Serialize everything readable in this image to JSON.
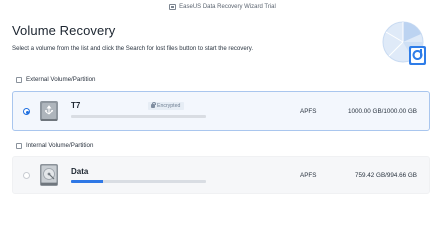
{
  "window": {
    "title": "EaseUS Data Recovery Wizard  Trial"
  },
  "page": {
    "title": "Volume Recovery",
    "subtitle": "Select a volume from the list and click the Search for lost files button to start the recovery."
  },
  "sections": [
    {
      "label": "External Volume/Partition",
      "volumes": [
        {
          "name": "T7",
          "badge": "Encrypted",
          "filesystem": "APFS",
          "capacity": "1000.00 GB/1000.00 GB",
          "used_fraction": 0.0,
          "selected": true,
          "icon": "usb-drive-icon"
        }
      ]
    },
    {
      "label": "Internal Volume/Partition",
      "volumes": [
        {
          "name": "Data",
          "filesystem": "APFS",
          "capacity": "759.42 GB/994.66 GB",
          "used_fraction": 0.24,
          "selected": false,
          "icon": "hard-drive-icon"
        }
      ]
    }
  ],
  "colors": {
    "accent": "#1f6fe0",
    "selected_row_bg": "#f3f7fd",
    "selected_row_border": "#a9c6ee"
  }
}
